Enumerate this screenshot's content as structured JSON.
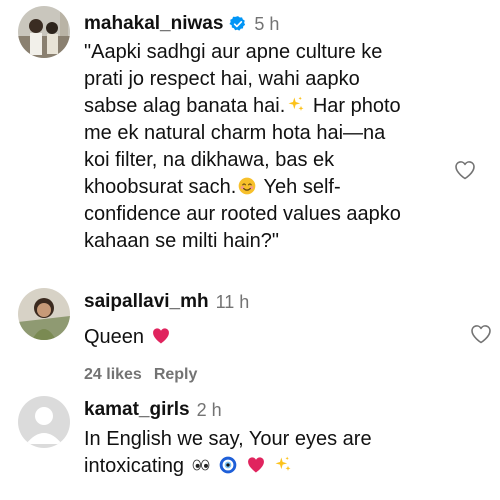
{
  "comments": [
    {
      "username": "mahakal_niwas",
      "verified": true,
      "time": "5 h",
      "text_line1": "\"Aapki sadhgi aur apne culture ke",
      "text_line2": "prati jo respect hai, wahi aapko",
      "text_line3": "sabse alag banata hai.",
      "text_line3_after": " Har photo",
      "text_line4": "me ek natural charm hota hai—na",
      "text_line5": "koi filter, na dikhawa, bas ek",
      "text_line6": "khoobsurat sach.",
      "text_line6_after": " Yeh self-",
      "text_line7": "confidence aur rooted values aapko",
      "text_line8": "kahaan se milti hain?\"",
      "icons": [
        "sparkles-emoji",
        "smiling-face-emoji",
        "heart-outline-icon"
      ]
    },
    {
      "username": "saipallavi_mh",
      "time": "11 h",
      "text": "Queen",
      "likes_label": "24 likes",
      "reply_label": "Reply",
      "icons": [
        "red-heart-emoji",
        "heart-outline-icon"
      ]
    },
    {
      "username": "kamat_girls",
      "time": "2 h",
      "text_line1": "In English we say, Your eyes are",
      "text_line2": "intoxicating",
      "icons": [
        "eyes-emoji",
        "nazar-amulet-emoji",
        "red-heart-emoji",
        "sparkles-emoji"
      ]
    }
  ],
  "colors": {
    "verified": "#0095f6",
    "secondary_text": "#737373",
    "heart": "#e0245e"
  }
}
